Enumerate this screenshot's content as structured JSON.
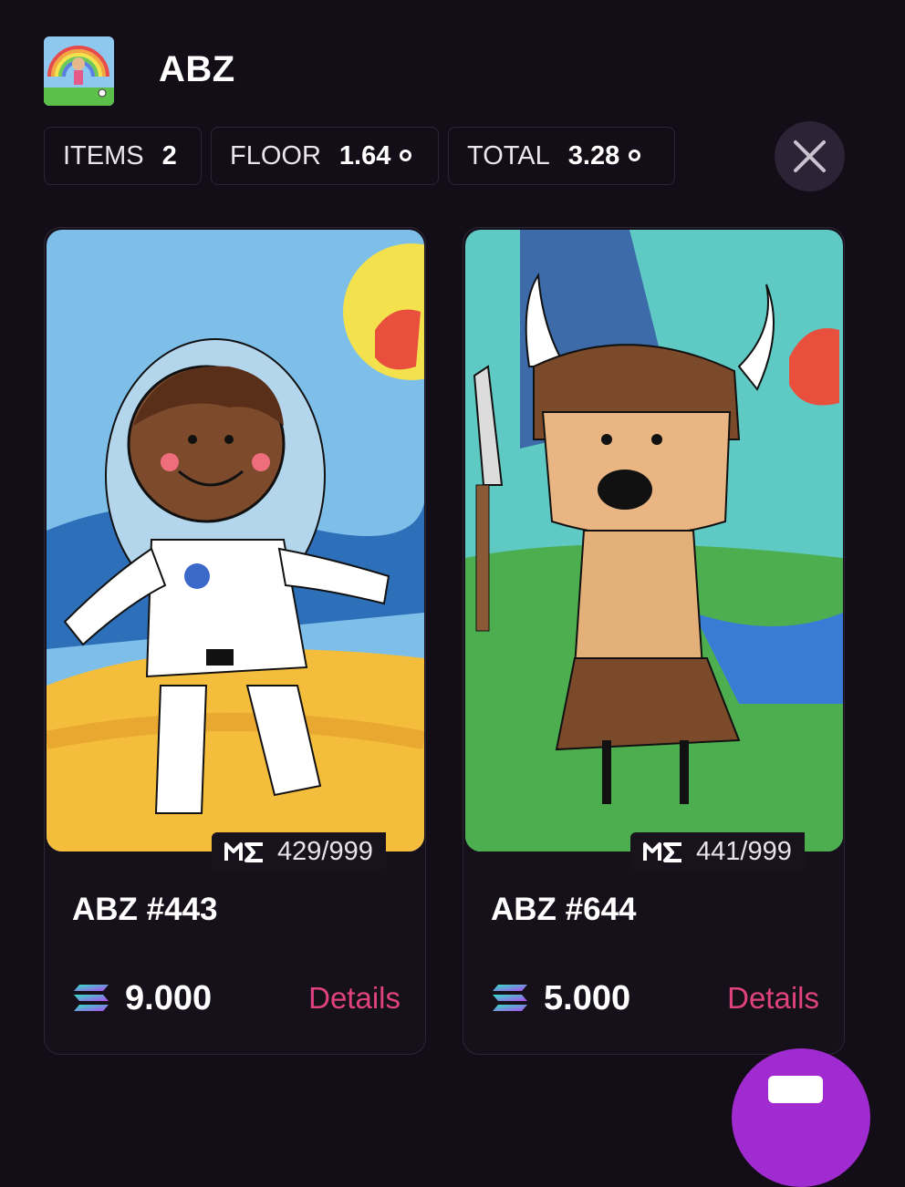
{
  "collection": {
    "name": "ABZ"
  },
  "stats": {
    "items_label": "ITEMS",
    "items_value": "2",
    "floor_label": "FLOOR",
    "floor_value": "1.64",
    "total_label": "TOTAL",
    "total_value": "3.28"
  },
  "cards": [
    {
      "name": "ABZ #443",
      "rank": "429/999",
      "price": "9.000",
      "details_label": "Details",
      "art": "astronaut-kid-drawing"
    },
    {
      "name": "ABZ #644",
      "rank": "441/999",
      "price": "5.000",
      "details_label": "Details",
      "art": "viking-kid-drawing"
    }
  ],
  "icons": {
    "close": "close-icon",
    "marketplace": "magic-eden-icon",
    "currency": "solana-icon",
    "coin": "coin-icon"
  },
  "colors": {
    "background": "#120d17",
    "accent": "#e0427f",
    "fab": "#a02bd0"
  }
}
